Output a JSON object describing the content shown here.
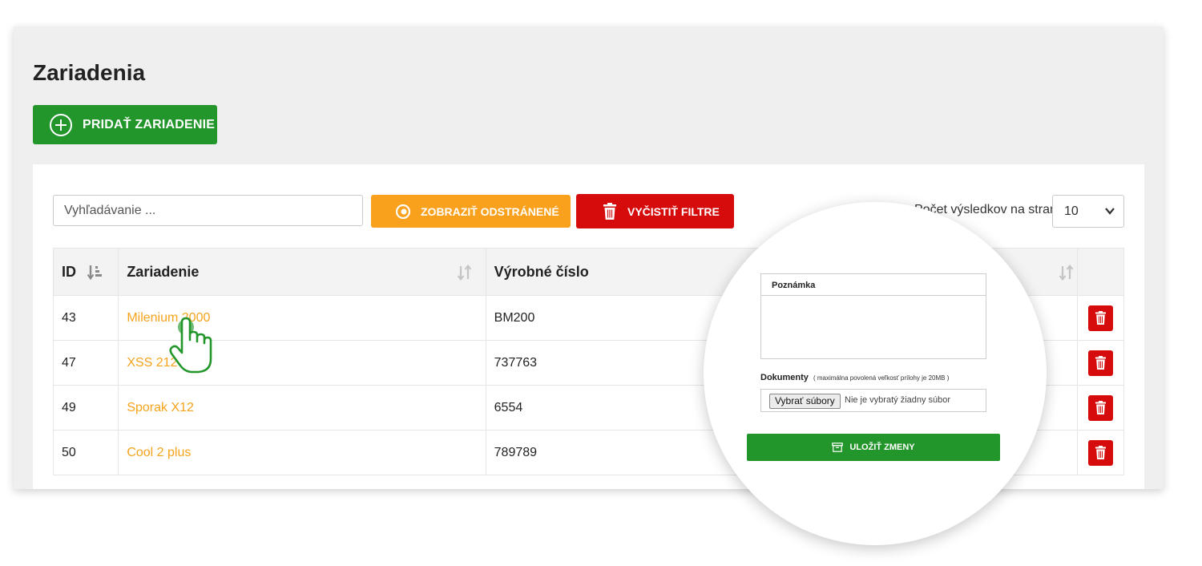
{
  "page": {
    "title": "Zariadenia"
  },
  "toolbar": {
    "add_label": "PRIDAŤ ZARIADENIE",
    "search_placeholder": "Vyhľadávanie ...",
    "show_deleted_label": "ZOBRAZIŤ ODSTRÁNENÉ",
    "clear_filters_label": "VYČISTIŤ FILTRE",
    "per_page_label": "Počet výsledkov na stranu",
    "per_page_value": "10"
  },
  "table": {
    "columns": [
      "ID",
      "Zariadenie",
      "Výrobné číslo"
    ],
    "rows": [
      {
        "id": "43",
        "name": "Milenium 2000",
        "serial": "BM200"
      },
      {
        "id": "47",
        "name": "XSS 212",
        "serial": "737763"
      },
      {
        "id": "49",
        "name": "Sporak X12",
        "serial": "6554"
      },
      {
        "id": "50",
        "name": "Cool 2 plus",
        "serial": "789789"
      }
    ]
  },
  "detail": {
    "note_label": "Poznámka",
    "docs_label": "Dokumenty",
    "docs_hint": "( maximálna povolená veľkosť prílohy je 20MB )",
    "file_button_label": "Vybrať súbory",
    "file_status": "Nie je vybratý žiadny súbor",
    "save_label": "ULOŽIŤ ZMENY"
  },
  "colors": {
    "primary_green": "#23962b",
    "accent_orange": "#f9a11d",
    "danger_red": "#d60b0b",
    "link_orange": "#f6a31b"
  },
  "icons": [
    "plus-circle-icon",
    "eye-icon",
    "trash-icon",
    "sort-icon",
    "chevron-down-icon",
    "pointer-hand-icon",
    "archive-icon"
  ]
}
